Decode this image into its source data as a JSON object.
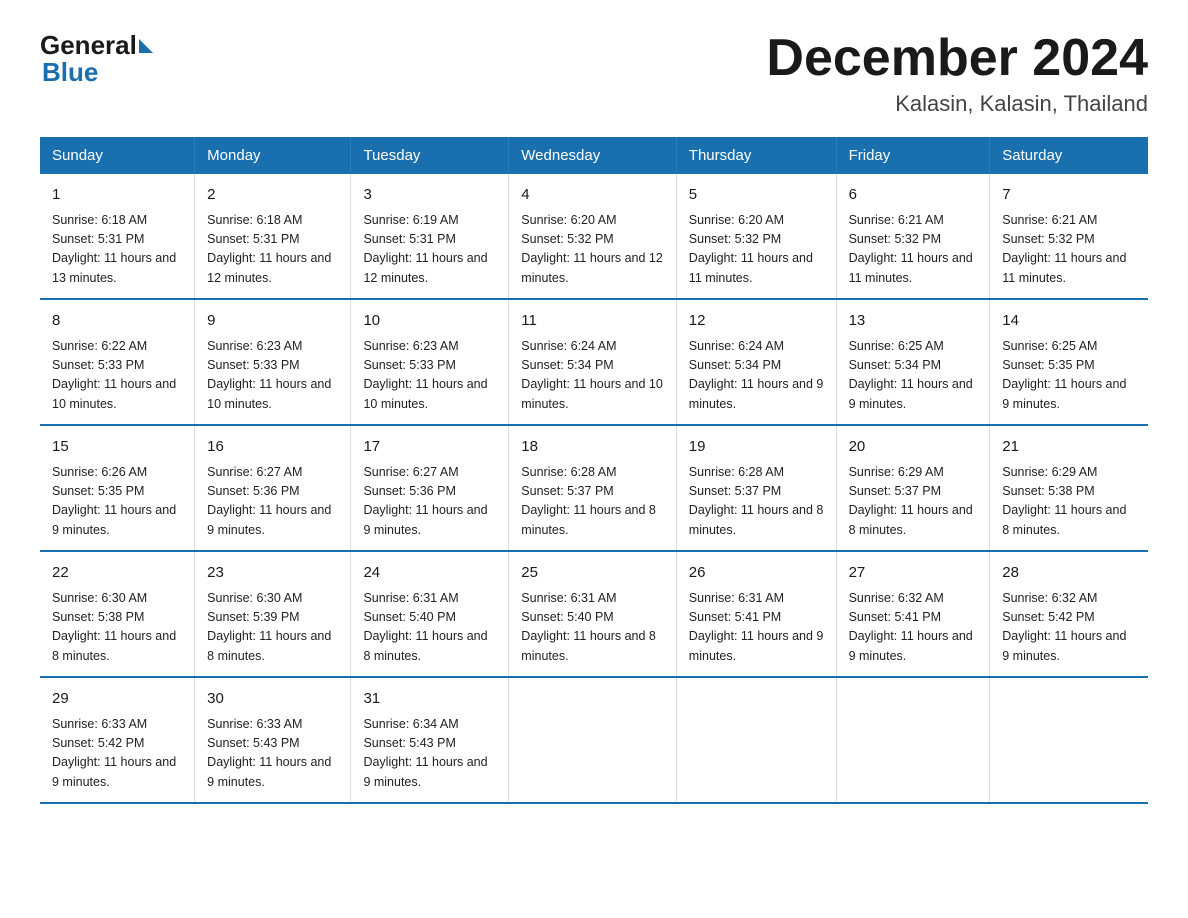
{
  "header": {
    "logo_general": "General",
    "logo_blue": "Blue",
    "month_title": "December 2024",
    "location": "Kalasin, Kalasin, Thailand"
  },
  "days_of_week": [
    "Sunday",
    "Monday",
    "Tuesday",
    "Wednesday",
    "Thursday",
    "Friday",
    "Saturday"
  ],
  "weeks": [
    [
      {
        "day": "1",
        "sunrise": "6:18 AM",
        "sunset": "5:31 PM",
        "daylight": "11 hours and 13 minutes."
      },
      {
        "day": "2",
        "sunrise": "6:18 AM",
        "sunset": "5:31 PM",
        "daylight": "11 hours and 12 minutes."
      },
      {
        "day": "3",
        "sunrise": "6:19 AM",
        "sunset": "5:31 PM",
        "daylight": "11 hours and 12 minutes."
      },
      {
        "day": "4",
        "sunrise": "6:20 AM",
        "sunset": "5:32 PM",
        "daylight": "11 hours and 12 minutes."
      },
      {
        "day": "5",
        "sunrise": "6:20 AM",
        "sunset": "5:32 PM",
        "daylight": "11 hours and 11 minutes."
      },
      {
        "day": "6",
        "sunrise": "6:21 AM",
        "sunset": "5:32 PM",
        "daylight": "11 hours and 11 minutes."
      },
      {
        "day": "7",
        "sunrise": "6:21 AM",
        "sunset": "5:32 PM",
        "daylight": "11 hours and 11 minutes."
      }
    ],
    [
      {
        "day": "8",
        "sunrise": "6:22 AM",
        "sunset": "5:33 PM",
        "daylight": "11 hours and 10 minutes."
      },
      {
        "day": "9",
        "sunrise": "6:23 AM",
        "sunset": "5:33 PM",
        "daylight": "11 hours and 10 minutes."
      },
      {
        "day": "10",
        "sunrise": "6:23 AM",
        "sunset": "5:33 PM",
        "daylight": "11 hours and 10 minutes."
      },
      {
        "day": "11",
        "sunrise": "6:24 AM",
        "sunset": "5:34 PM",
        "daylight": "11 hours and 10 minutes."
      },
      {
        "day": "12",
        "sunrise": "6:24 AM",
        "sunset": "5:34 PM",
        "daylight": "11 hours and 9 minutes."
      },
      {
        "day": "13",
        "sunrise": "6:25 AM",
        "sunset": "5:34 PM",
        "daylight": "11 hours and 9 minutes."
      },
      {
        "day": "14",
        "sunrise": "6:25 AM",
        "sunset": "5:35 PM",
        "daylight": "11 hours and 9 minutes."
      }
    ],
    [
      {
        "day": "15",
        "sunrise": "6:26 AM",
        "sunset": "5:35 PM",
        "daylight": "11 hours and 9 minutes."
      },
      {
        "day": "16",
        "sunrise": "6:27 AM",
        "sunset": "5:36 PM",
        "daylight": "11 hours and 9 minutes."
      },
      {
        "day": "17",
        "sunrise": "6:27 AM",
        "sunset": "5:36 PM",
        "daylight": "11 hours and 9 minutes."
      },
      {
        "day": "18",
        "sunrise": "6:28 AM",
        "sunset": "5:37 PM",
        "daylight": "11 hours and 8 minutes."
      },
      {
        "day": "19",
        "sunrise": "6:28 AM",
        "sunset": "5:37 PM",
        "daylight": "11 hours and 8 minutes."
      },
      {
        "day": "20",
        "sunrise": "6:29 AM",
        "sunset": "5:37 PM",
        "daylight": "11 hours and 8 minutes."
      },
      {
        "day": "21",
        "sunrise": "6:29 AM",
        "sunset": "5:38 PM",
        "daylight": "11 hours and 8 minutes."
      }
    ],
    [
      {
        "day": "22",
        "sunrise": "6:30 AM",
        "sunset": "5:38 PM",
        "daylight": "11 hours and 8 minutes."
      },
      {
        "day": "23",
        "sunrise": "6:30 AM",
        "sunset": "5:39 PM",
        "daylight": "11 hours and 8 minutes."
      },
      {
        "day": "24",
        "sunrise": "6:31 AM",
        "sunset": "5:40 PM",
        "daylight": "11 hours and 8 minutes."
      },
      {
        "day": "25",
        "sunrise": "6:31 AM",
        "sunset": "5:40 PM",
        "daylight": "11 hours and 8 minutes."
      },
      {
        "day": "26",
        "sunrise": "6:31 AM",
        "sunset": "5:41 PM",
        "daylight": "11 hours and 9 minutes."
      },
      {
        "day": "27",
        "sunrise": "6:32 AM",
        "sunset": "5:41 PM",
        "daylight": "11 hours and 9 minutes."
      },
      {
        "day": "28",
        "sunrise": "6:32 AM",
        "sunset": "5:42 PM",
        "daylight": "11 hours and 9 minutes."
      }
    ],
    [
      {
        "day": "29",
        "sunrise": "6:33 AM",
        "sunset": "5:42 PM",
        "daylight": "11 hours and 9 minutes."
      },
      {
        "day": "30",
        "sunrise": "6:33 AM",
        "sunset": "5:43 PM",
        "daylight": "11 hours and 9 minutes."
      },
      {
        "day": "31",
        "sunrise": "6:34 AM",
        "sunset": "5:43 PM",
        "daylight": "11 hours and 9 minutes."
      },
      {
        "day": "",
        "sunrise": "",
        "sunset": "",
        "daylight": ""
      },
      {
        "day": "",
        "sunrise": "",
        "sunset": "",
        "daylight": ""
      },
      {
        "day": "",
        "sunrise": "",
        "sunset": "",
        "daylight": ""
      },
      {
        "day": "",
        "sunrise": "",
        "sunset": "",
        "daylight": ""
      }
    ]
  ],
  "labels": {
    "sunrise_prefix": "Sunrise: ",
    "sunset_prefix": "Sunset: ",
    "daylight_prefix": "Daylight: "
  }
}
